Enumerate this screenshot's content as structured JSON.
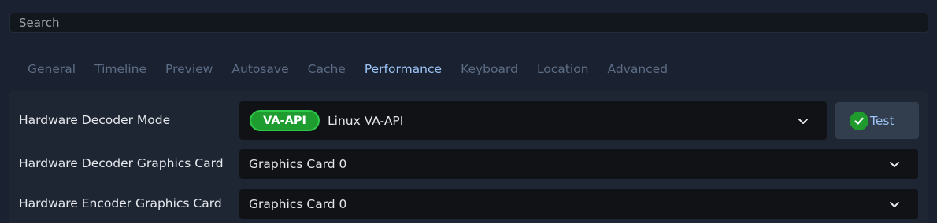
{
  "search": {
    "placeholder": "Search"
  },
  "tabs": [
    {
      "label": "General"
    },
    {
      "label": "Timeline"
    },
    {
      "label": "Preview"
    },
    {
      "label": "Autosave"
    },
    {
      "label": "Cache"
    },
    {
      "label": "Performance",
      "active": true
    },
    {
      "label": "Keyboard"
    },
    {
      "label": "Location"
    },
    {
      "label": "Advanced"
    }
  ],
  "settings": {
    "decoder_mode": {
      "label": "Hardware Decoder Mode",
      "badge": "VA-API",
      "value": "Linux VA-API"
    },
    "decoder_card": {
      "label": "Hardware Decoder Graphics Card",
      "value": "Graphics Card 0"
    },
    "encoder_card": {
      "label": "Hardware Encoder Graphics Card",
      "value": "Graphics Card 0"
    }
  },
  "test_button": {
    "label": "Test",
    "icon": "check-circle-icon"
  },
  "colors": {
    "background": "#1a2130",
    "active_tab": "#9cc3f5",
    "inactive_tab": "#5c6d85",
    "badge_green": "#1e9c30"
  }
}
